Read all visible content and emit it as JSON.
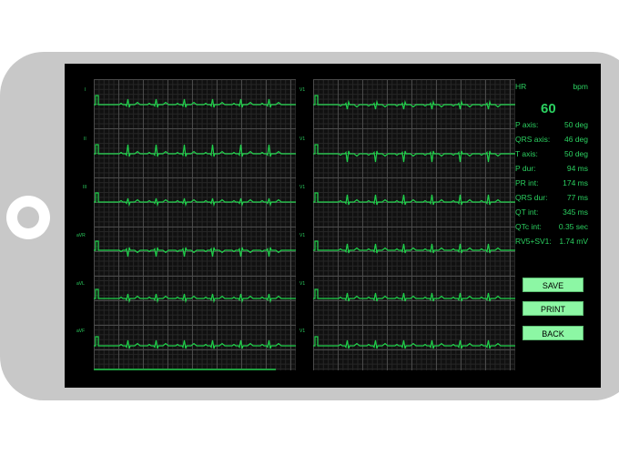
{
  "leads": {
    "left": [
      "I",
      "II",
      "III",
      "aVR",
      "aVL",
      "aVF"
    ],
    "right": [
      "V1",
      "V1",
      "V1",
      "V1",
      "V1",
      "V1"
    ]
  },
  "readout": {
    "hr_label": "HR",
    "hr_unit": "bpm",
    "hr_value": "60",
    "items": [
      {
        "label": "P axis:",
        "value": "50 deg"
      },
      {
        "label": "QRS axis:",
        "value": "46 deg"
      },
      {
        "label": "T axis:",
        "value": "50 deg"
      },
      {
        "label": "P dur:",
        "value": "94 ms"
      },
      {
        "label": "PR int:",
        "value": "174 ms"
      },
      {
        "label": "QRS dur:",
        "value": "77 ms"
      },
      {
        "label": "QT int:",
        "value": "345 ms"
      },
      {
        "label": "QTc int:",
        "value": "0.35 sec"
      },
      {
        "label": "RV5+SV1:",
        "value": "1.74 mV"
      }
    ]
  },
  "buttons": {
    "save": "SAVE",
    "print": "PRINT",
    "back": "BACK"
  },
  "colors": {
    "trace": "#1fd04a",
    "text": "#2bd060",
    "button_bg": "#8cf7a4",
    "screen_bg": "#000000",
    "device": "#c8c8c8"
  }
}
